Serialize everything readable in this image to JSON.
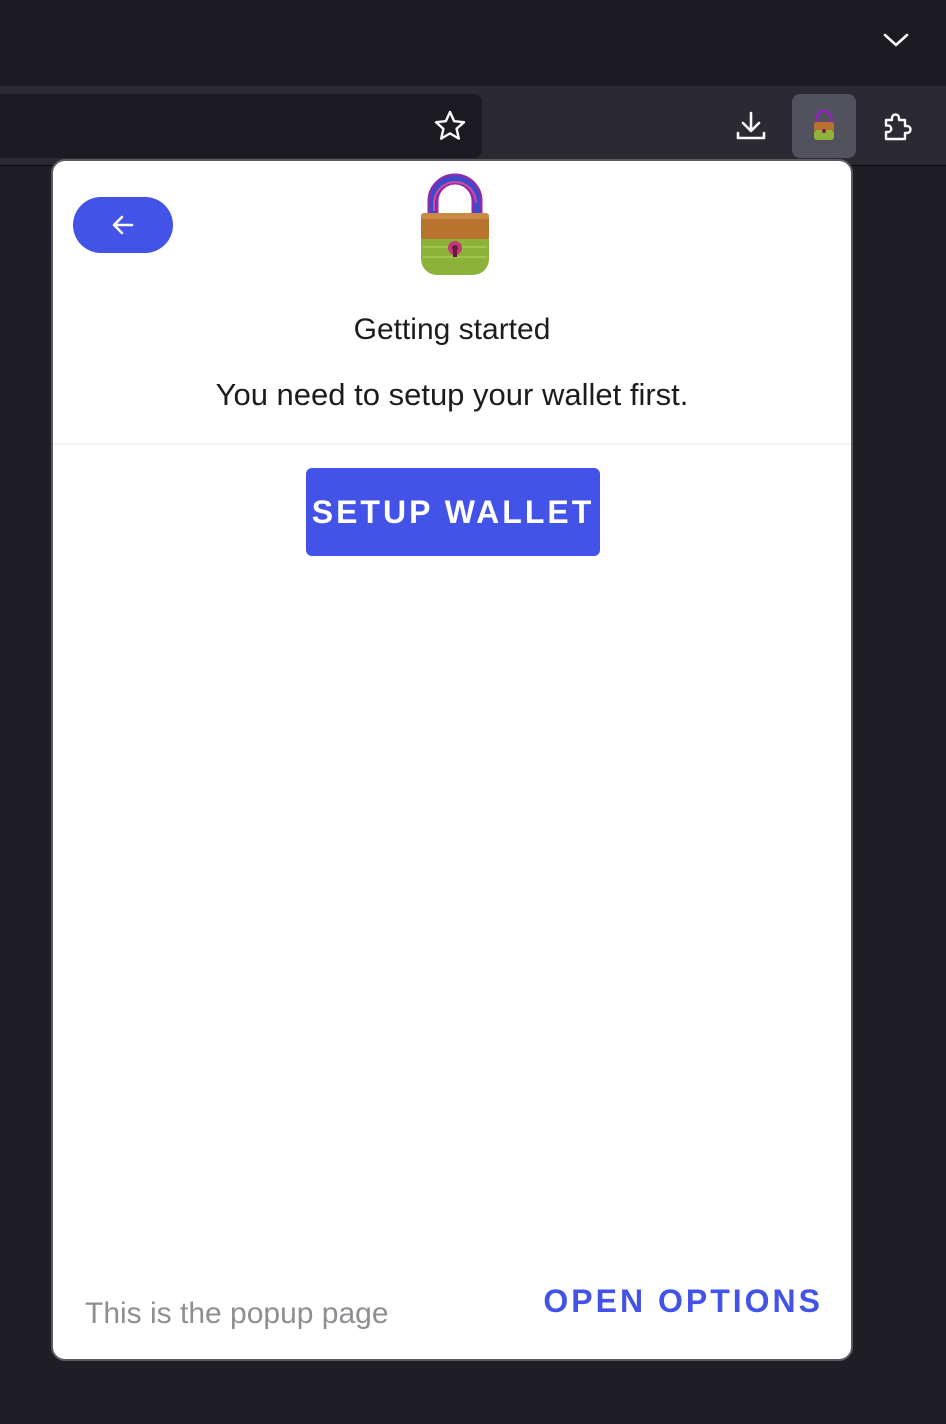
{
  "browser": {
    "tab_list_icon": "chevron-down-icon",
    "star_icon": "star-icon",
    "download_icon": "download-icon",
    "extension_icon": "wallet-lock-icon",
    "extensions_icon": "puzzle-icon"
  },
  "popup": {
    "back_icon": "arrow-left-icon",
    "logo": "padlock-logo",
    "title": "Getting started",
    "subtitle": "You need to setup your wallet first.",
    "setup_button_label": "SETUP WALLET",
    "footer_text": "This is the popup page",
    "open_options_label": "OPEN OPTIONS"
  },
  "colors": {
    "accent": "#4353e8",
    "chrome_dark": "#1c1b22",
    "toolbar": "#2b2a33"
  }
}
